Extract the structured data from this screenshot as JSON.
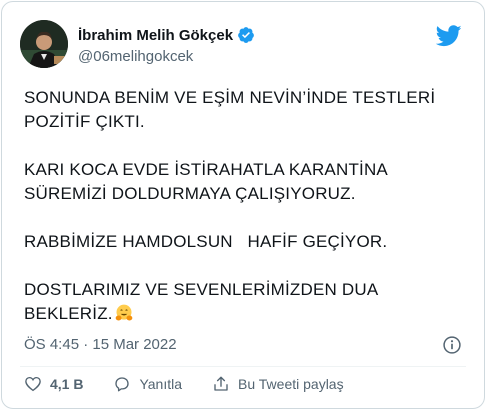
{
  "author": {
    "name": "İbrahim Melih Gökçek",
    "handle": "@06melihgokcek",
    "verified": true
  },
  "tweet": {
    "paragraphs": [
      "SONUNDA BENİM VE EŞİM NEVİN’İNDE TESTLERİ POZİTİF ÇIKTI.",
      "KARI KOCA EVDE İSTİRAHATLA KARANTİNA SÜREMİZİ DOLDURMAYA ÇALIŞIYORUZ.",
      "RABBİMİZE HAMDOLSUN   HAFİF GEÇİYOR.",
      "DOSTLARIMIZ VE SEVENLERİMİZDEN DUA BEKLERİZ."
    ],
    "emoji": "hugging-face-emoji",
    "timestamp": "ÖS 4:45 · 15 Mar 2022"
  },
  "actions": {
    "like_count": "4,1 B",
    "reply_label": "Yanıtla",
    "share_label": "Bu Tweeti paylaş"
  },
  "colors": {
    "brand_blue": "#1d9bf0",
    "text": "#0f1419",
    "muted": "#536471",
    "border": "#cfd9de"
  }
}
